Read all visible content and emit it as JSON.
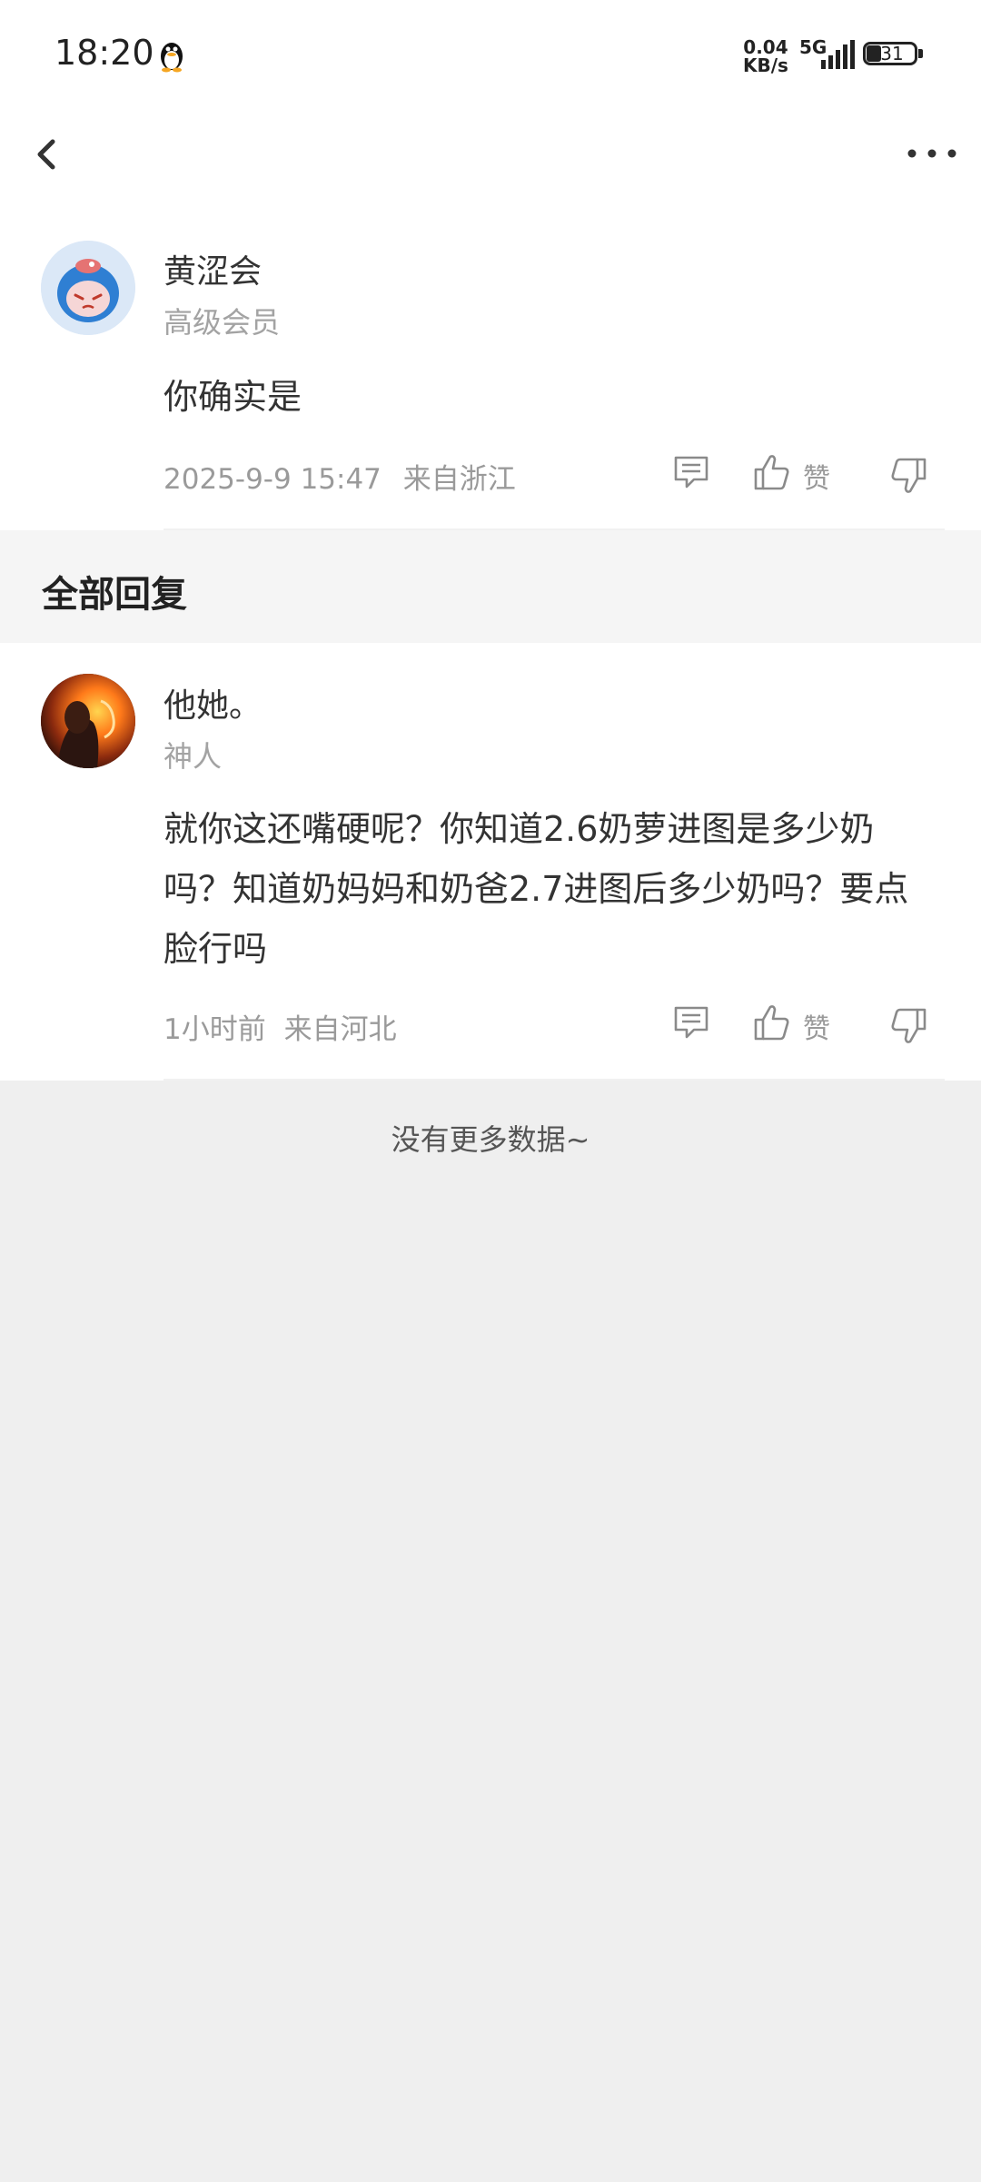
{
  "status_bar": {
    "time": "18:20",
    "net_speed_value": "0.04",
    "net_speed_unit": "KB/s",
    "network": "5G",
    "battery": "31"
  },
  "icons": {
    "back": "back-arrow-icon",
    "more": "more-options-icon",
    "reply": "comment-icon",
    "like": "thumb-up-icon",
    "dislike": "thumb-down-icon",
    "notification": "qq-penguin-icon"
  },
  "main_comment": {
    "username": "黄涩会",
    "badge": "高级会员",
    "content": "你确实是",
    "time": "2025-9-9 15:47",
    "location": "来自浙江",
    "like_label": "赞"
  },
  "section": {
    "title": "全部回复"
  },
  "replies": [
    {
      "username": "他她。",
      "badge": "神人",
      "content": "就你这还嘴硬呢？你知道2.6奶萝进图是多少奶吗？知道奶妈妈和奶爸2.7进图后多少奶吗？要点脸行吗",
      "time": "1小时前",
      "location": "来自河北",
      "like_label": "赞"
    }
  ],
  "footer": {
    "no_more": "没有更多数据~"
  },
  "colors": {
    "background": "#efefef",
    "card": "#ffffff",
    "secondary_text": "#9a9a9a",
    "primary_text": "#333333"
  }
}
